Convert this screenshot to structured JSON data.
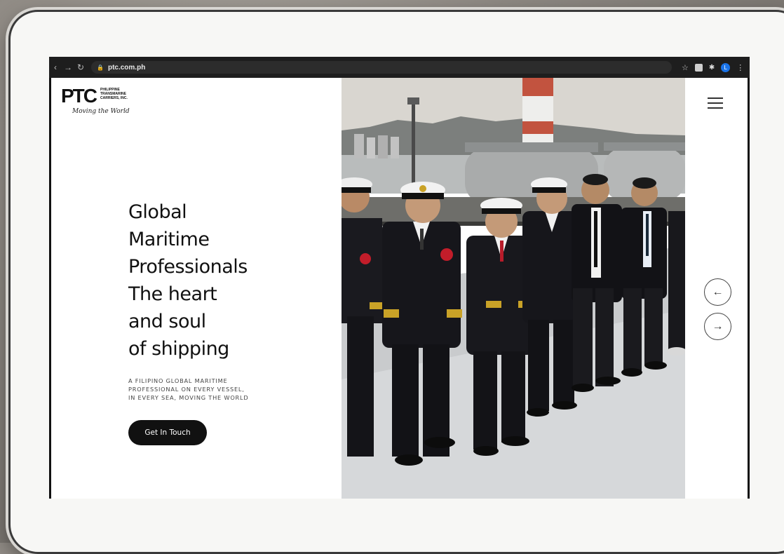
{
  "browser": {
    "url": "ptc.com.ph",
    "profile_initial": "L"
  },
  "logo": {
    "mark": "PTC",
    "company_lines": [
      "PHILIPPINE",
      "TRANSMARINE",
      "CARRIERS, INC."
    ],
    "tagline": "Moving the World"
  },
  "hero": {
    "title_lines": [
      "Global",
      "Maritime",
      "Professionals",
      "The heart",
      "and soul",
      "of shipping"
    ],
    "subtitle_lines": [
      "A FILIPINO GLOBAL MARITIME",
      "PROFESSIONAL ON EVERY VESSEL,",
      "IN EVERY SEA, MOVING THE WORLD"
    ],
    "cta_label": "Get In Touch"
  },
  "colors": {
    "accent": "#111111",
    "tie_red": "#b81c2a"
  },
  "icons": {
    "menu": "hamburger-icon",
    "prev": "arrow-left-icon",
    "next": "arrow-right-icon"
  }
}
